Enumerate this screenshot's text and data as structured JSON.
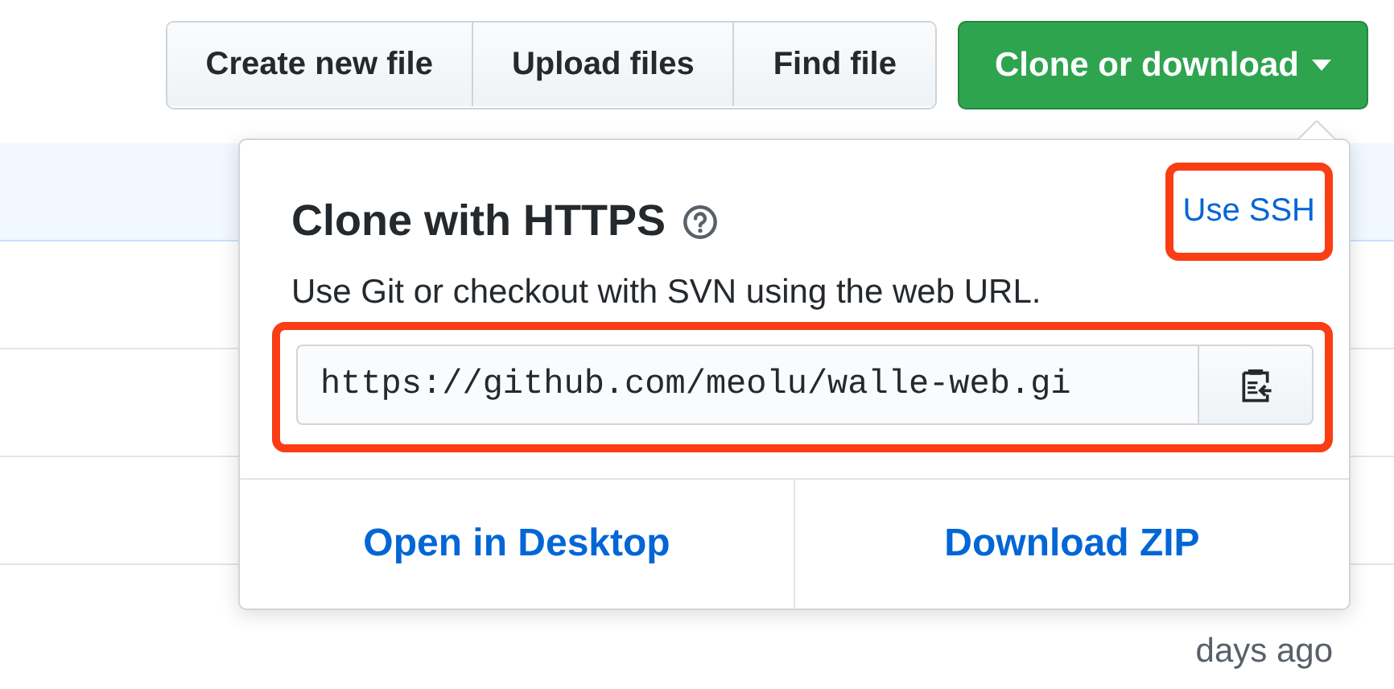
{
  "toolbar": {
    "buttons": [
      {
        "label": "Create new file"
      },
      {
        "label": "Upload files"
      },
      {
        "label": "Find file"
      }
    ],
    "clone_button": {
      "label": "Clone or download",
      "expanded": true
    }
  },
  "background_rows": {
    "count_hint": "days ago"
  },
  "clone_popup": {
    "title": "Clone with HTTPS",
    "switch_link": {
      "label": "Use SSH",
      "highlighted": true
    },
    "description": "Use Git or checkout with SVN using the web URL.",
    "url_field": {
      "value": "https://github.com/meolu/walle-web.gi",
      "highlighted": true
    },
    "actions": [
      {
        "label": "Open in Desktop"
      },
      {
        "label": "Download ZIP"
      }
    ]
  }
}
